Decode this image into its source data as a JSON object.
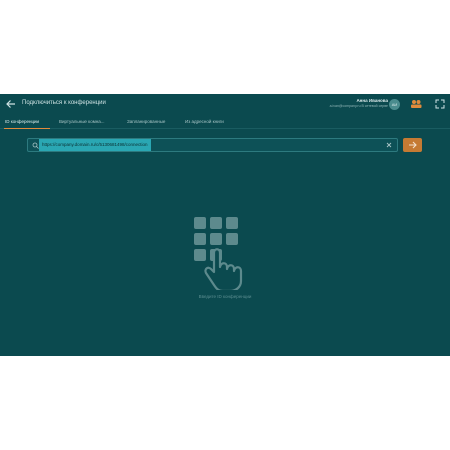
{
  "header": {
    "title": "Подключиться к конференции",
    "user_name": "Анна Иванова",
    "user_status": "a.ivan@company.ru В сетевой серве",
    "avatar_initials": "АИ"
  },
  "tabs": [
    {
      "label": "ID конференции",
      "active": true
    },
    {
      "label": "Виртуальные комна..."
    },
    {
      "label": "Запланированные"
    },
    {
      "label": "Из адресной книги"
    }
  ],
  "search": {
    "value": "https://company.domain.ru/c/5130681498/connection"
  },
  "hint": "Введите ID конференции",
  "colors": {
    "background": "#0b4a4f",
    "accent": "#e08b3c",
    "selection": "#2aa7b3"
  }
}
